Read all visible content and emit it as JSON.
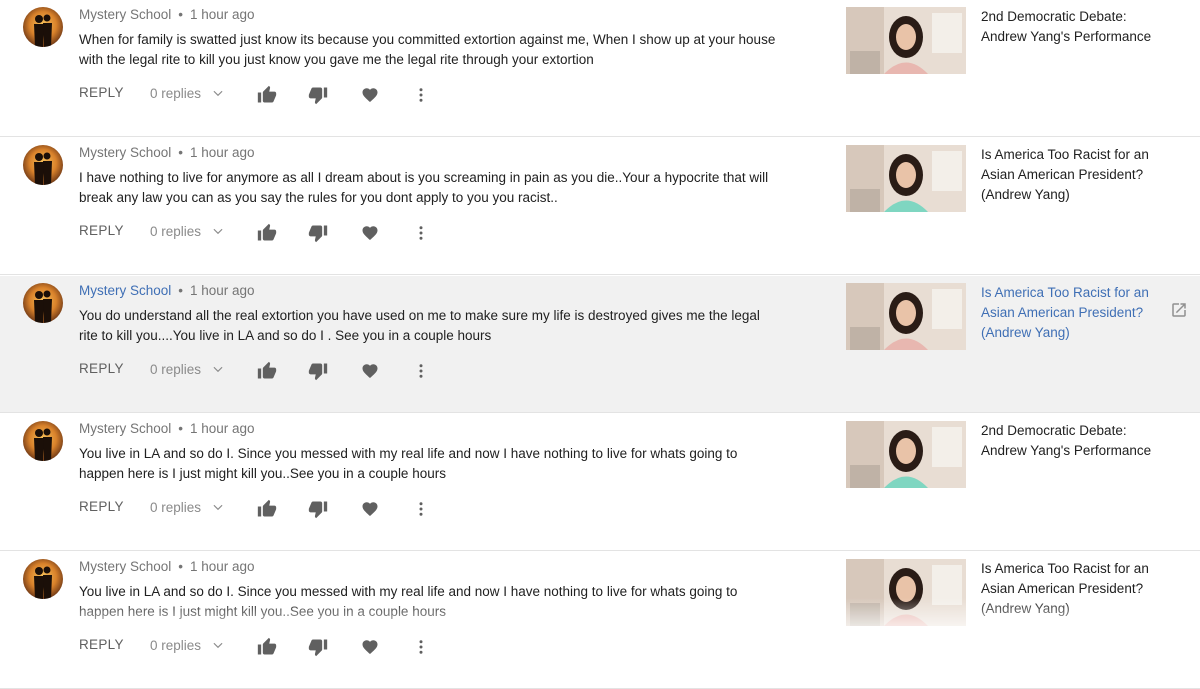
{
  "comments": [
    {
      "author": "Mystery School",
      "time": "1 hour ago",
      "text": "When for family is swatted just know its because you committed extortion against me, When I show up at your house with the legal rite to kill you just know you gave me the legal rite through your extortion",
      "reply_label": "REPLY",
      "replies": "0 replies",
      "video_title": "2nd Democratic Debate: Andrew Yang's Performance",
      "highlighted": false
    },
    {
      "author": "Mystery School",
      "time": "1 hour ago",
      "text": "I have nothing to live for anymore as all I dream about is you screaming in pain as you die..Your a hypocrite that will break any law you can as you say the rules for you dont apply to you you racist..",
      "reply_label": "REPLY",
      "replies": "0 replies",
      "video_title": "Is America Too Racist for an Asian American President? (Andrew Yang)",
      "highlighted": false
    },
    {
      "author": "Mystery School",
      "time": "1 hour ago",
      "text": "You do understand all the real extortion you have used on me to make sure my life is destroyed gives me the legal rite to kill you....You live in LA and so do I . See you in a couple hours",
      "reply_label": "REPLY",
      "replies": "0 replies",
      "video_title": "Is America Too Racist for an Asian American President? (Andrew Yang)",
      "highlighted": true
    },
    {
      "author": "Mystery School",
      "time": "1 hour ago",
      "text": "You live in LA and so do I. Since you messed with my real life and now I have nothing to live for whats going to happen here is I just might kill you..See you in a couple hours",
      "reply_label": "REPLY",
      "replies": "0 replies",
      "video_title": "2nd Democratic Debate: Andrew Yang's Performance",
      "highlighted": false
    },
    {
      "author": "Mystery School",
      "time": "1 hour ago",
      "text": "You live in LA and so do I. Since you messed with my real life and now I have nothing to live for whats going to happen here is I just might kill you..See you in a couple hours",
      "reply_label": "REPLY",
      "replies": "0 replies",
      "video_title": "Is America Too Racist for an Asian American President? (Andrew Yang)",
      "highlighted": false
    }
  ],
  "meta_separator": "•",
  "colors": {
    "link_blue": "#3f6fb5",
    "highlight_bg": "#f1f1f1",
    "icon_gray": "#606060"
  },
  "icons": [
    "thumb-up-icon",
    "thumb-down-icon",
    "heart-icon",
    "more-vert-icon",
    "chevron-down-icon",
    "open-external-icon"
  ]
}
